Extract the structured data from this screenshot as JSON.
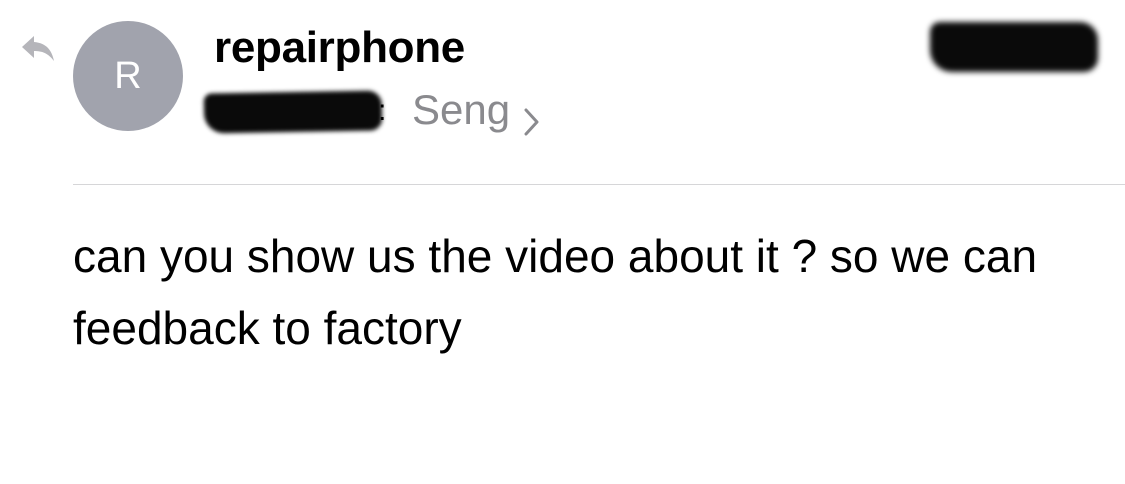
{
  "message": {
    "reply_icon": "reply-arrow-icon",
    "avatar_initial": "R",
    "sender_name": "repairphone",
    "recipient_label": "Seng",
    "chevron_icon": "chevron-right-icon",
    "recipient_prefix_colon": ":",
    "body": "can you show us the video about it ? so we can feedback to factory"
  },
  "colors": {
    "avatar_bg": "#a1a3ad",
    "secondary_text": "#8a8a8e",
    "divider": "#d6d6d8",
    "icon_gray": "#b5b5ba"
  }
}
